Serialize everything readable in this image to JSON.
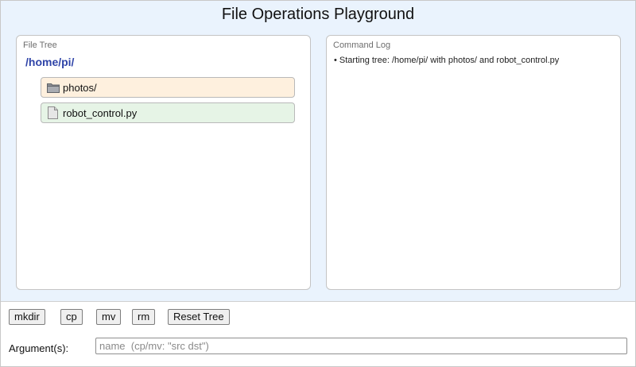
{
  "app": {
    "title": "File Operations Playground"
  },
  "file_tree": {
    "panel_label": "File Tree",
    "root_path": "/home/pi/",
    "items": [
      {
        "label": "photos/",
        "kind": "folder",
        "icon": "folder-icon",
        "color": "#fef0de"
      },
      {
        "label": "robot_control.py",
        "kind": "file",
        "icon": "file-icon",
        "color": "#e6f4e6"
      }
    ]
  },
  "command_log": {
    "panel_label": "Command Log",
    "entries": [
      "• Starting tree: /home/pi/ with photos/ and robot_control.py"
    ]
  },
  "toolbar": {
    "mkdir_label": "mkdir",
    "cp_label": "cp",
    "mv_label": "mv",
    "rm_label": "rm",
    "reset_label": "Reset Tree"
  },
  "argument": {
    "label": "Argument(s):",
    "value": "",
    "placeholder": "name  (cp/mv: \"src dst\")"
  },
  "colors": {
    "top_background": "#eaf3fd",
    "root_path": "#2f44a8"
  }
}
